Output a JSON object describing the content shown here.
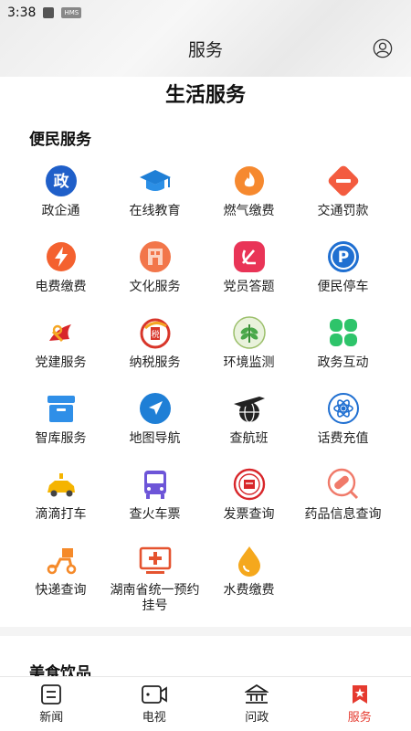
{
  "status": {
    "time": "3:38",
    "badge": "HMS"
  },
  "header": {
    "title": "服务"
  },
  "page": {
    "big_title": "生活服务",
    "section_title": "便民服务",
    "next_section_title": "美食饮品"
  },
  "services": [
    {
      "label": "政企通",
      "icon": "zheng-badge-icon"
    },
    {
      "label": "在线教育",
      "icon": "graduation-cap-icon"
    },
    {
      "label": "燃气缴费",
      "icon": "flame-icon"
    },
    {
      "label": "交通罚款",
      "icon": "no-entry-icon"
    },
    {
      "label": "电费缴费",
      "icon": "lightning-icon"
    },
    {
      "label": "文化服务",
      "icon": "building-icon"
    },
    {
      "label": "党员答题",
      "icon": "party-emblem-icon"
    },
    {
      "label": "便民停车",
      "icon": "parking-icon"
    },
    {
      "label": "党建服务",
      "icon": "party-flag-icon"
    },
    {
      "label": "纳税服务",
      "icon": "tax-seal-icon"
    },
    {
      "label": "环境监测",
      "icon": "leaf-icon"
    },
    {
      "label": "政务互动",
      "icon": "clover-icon"
    },
    {
      "label": "智库服务",
      "icon": "archive-box-icon"
    },
    {
      "label": "地图导航",
      "icon": "navigation-arrow-icon"
    },
    {
      "label": "查航班",
      "icon": "airplane-globe-icon"
    },
    {
      "label": "话费充值",
      "icon": "atom-icon"
    },
    {
      "label": "滴滴打车",
      "icon": "car-icon"
    },
    {
      "label": "查火车票",
      "icon": "bus-icon"
    },
    {
      "label": "发票查询",
      "icon": "seal-icon"
    },
    {
      "label": "药品信息查询",
      "icon": "pill-icon"
    },
    {
      "label": "快递查询",
      "icon": "scooter-icon"
    },
    {
      "label": "湖南省统一预约挂号",
      "icon": "medical-monitor-icon"
    },
    {
      "label": "水费缴费",
      "icon": "water-drop-icon"
    }
  ],
  "tabs": [
    {
      "label": "新闻",
      "icon": "news-icon"
    },
    {
      "label": "电视",
      "icon": "tv-camera-icon"
    },
    {
      "label": "问政",
      "icon": "government-building-icon"
    },
    {
      "label": "服务",
      "icon": "service-flag-icon",
      "active": true
    }
  ],
  "colors": {
    "accent": "#e53a2f",
    "blue": "#1f6fd1",
    "orange": "#f5822a",
    "green": "#2ec46a"
  }
}
